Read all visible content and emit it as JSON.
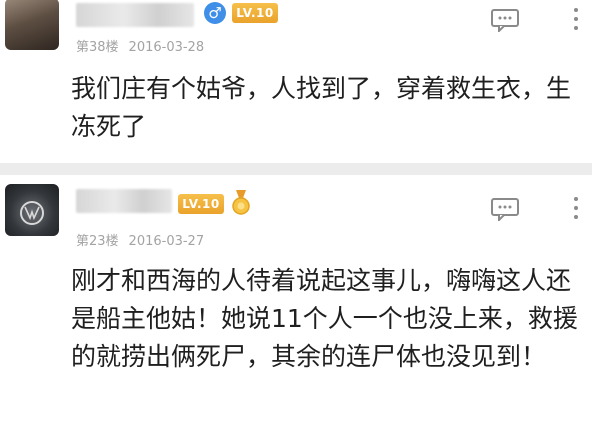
{
  "posts": [
    {
      "floor": "第38楼",
      "date": "2016-03-28",
      "gender_icon": "♂",
      "level": "LV.10",
      "content": "我们庄有个姑爷，人找到了，穿着救生衣，生冻死了"
    },
    {
      "floor": "第23楼",
      "date": "2016-03-27",
      "level": "LV.10",
      "content": "刚才和西海的人待着说起这事儿，嗨嗨这人还是船主他姑！她说11个人一个也没上来，救援的就捞出俩死尸，其余的连尸体也没见到！"
    }
  ],
  "colors": {
    "gender": "#3f8fe8",
    "level": "#f0b03a",
    "meta": "#a3a3a3"
  }
}
